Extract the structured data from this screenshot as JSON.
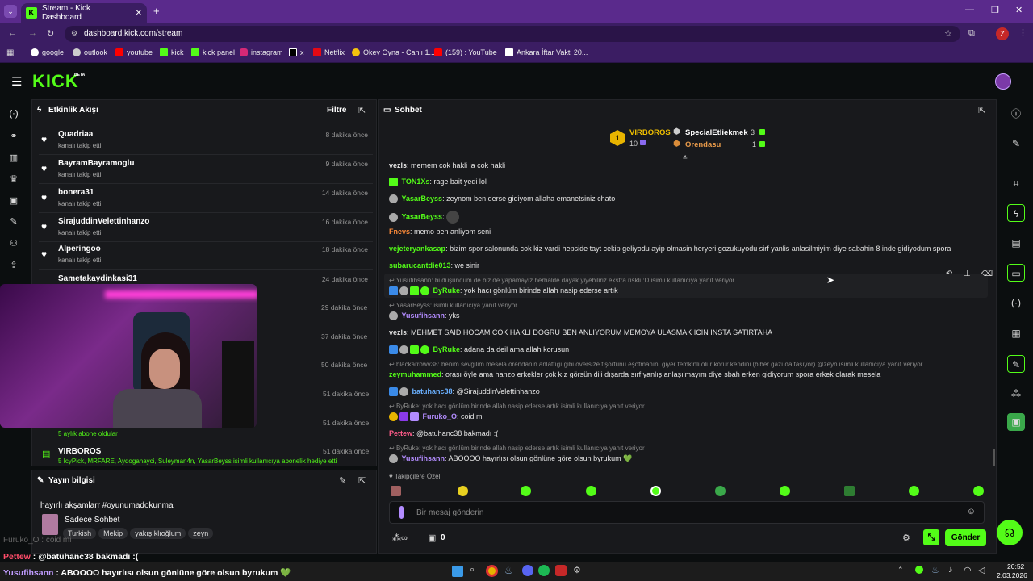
{
  "browser": {
    "tab_title": "Stream - Kick Dashboard",
    "url": "dashboard.kick.com/stream",
    "profile": "Z",
    "bookmarks": [
      "google",
      "outlook",
      "youtube",
      "kick",
      "kick panel",
      "instagram",
      "x",
      "Netflix",
      "Okey Oyna - Canlı 1...",
      "(159) : YouTube",
      "Ankara İftar Vakti 20..."
    ]
  },
  "app": {
    "logo": "KICK",
    "beta": "BETA"
  },
  "activity": {
    "title": "Etkinlik Akışı",
    "filter": "Filtre",
    "items": [
      {
        "name": "Quadriaa",
        "sub": "kanalı takip etti",
        "time": "8 dakika önce"
      },
      {
        "name": "BayramBayramoglu",
        "sub": "kanalı takip etti",
        "time": "9 dakika önce"
      },
      {
        "name": "bonera31",
        "sub": "kanalı takip etti",
        "time": "14 dakika önce"
      },
      {
        "name": "SirajuddinVelettinhanzo",
        "sub": "kanalı takip etti",
        "time": "16 dakika önce"
      },
      {
        "name": "Alperingoo",
        "sub": "kanalı takip etti",
        "time": "18 dakika önce"
      },
      {
        "name": "Sametakaydinkasi31",
        "sub": "",
        "time": "24 dakika önce"
      }
    ],
    "hidden_times": [
      "29 dakika önce",
      "37 dakika önce",
      "50 dakika önce",
      "51 dakika önce",
      "51 dakika önce"
    ],
    "sub_line": "5 aylık abone oldular",
    "gift_name": "VIRBOROS",
    "gift_time": "51 dakika önce",
    "gift_line": "5 IcyPick, MRFARE, Aydoganayci, Suleyman4n, YasarBeyss isimli kullanıcıya abonelik hediye etti"
  },
  "stream_info": {
    "title": "Yayın bilgisi",
    "stream_title": "hayırlı akşamlarr #oyunumadokunma",
    "category": "Sadece Sohbet",
    "tags": [
      "Turkish",
      "Mekip",
      "yakışıklıoğlum",
      "zeyn"
    ]
  },
  "chat": {
    "title": "Sohbet",
    "leaderboard": {
      "first": "VIRBOROS",
      "first_count": "10",
      "second": "SpecialEtliekmek",
      "second_count": "3",
      "third": "Orendasu",
      "third_count": "1"
    },
    "messages": [
      {
        "user": "vezls",
        "text": "memem cok hakli la cok hakli",
        "color": "#ddd"
      },
      {
        "user": "TON1Xs",
        "text": "rage bait yedi lol",
        "color": "#53fc18"
      },
      {
        "user": "YasarBeyss",
        "text": "zeynom ben derse gidiyom allaha emanetsiniz chato",
        "color": "#53fc18"
      },
      {
        "user": "YasarBeyss",
        "text": "",
        "color": "#53fc18"
      },
      {
        "user": "Fnevs",
        "text": "memo ben anliyom seni",
        "color": "#ff8c3a"
      },
      {
        "user": "vejeteryankasap",
        "text": "bizim spor salonunda cok kiz vardi hepside tayt cekip geliyodu ayip olmasin heryeri gozukuyodu sirf yanlis anlasilmiyim diye sabahin 8 inde gidiyodum spora",
        "color": "#53fc18"
      },
      {
        "user": "subarucantdie013",
        "text": "we sinir",
        "color": "#53fc18"
      },
      {
        "user": "ByRuke",
        "text": "yok hacı gönlüm birinde allah nasip ederse artık",
        "color": "#53fc18",
        "reply": "Yusufihsann: bi düşündüm de biz de yapamayız herhalde dayak yiyebiliriz ekstra riskli :D isimli kullanıcıya yanıt veriyor"
      },
      {
        "user": "Yusufihsann",
        "text": "yks",
        "color": "#b38cff",
        "reply": "YasarBeyss:  isimli kullanıcıya yanıt veriyor"
      },
      {
        "user": "vezls",
        "text": "MEHMET SAID HOCAM COK HAKLI DOGRU BEN ANLIYORUM MEMOYA ULASMAK ICIN INSTA SATIRTAHA",
        "color": "#ddd"
      },
      {
        "user": "ByRuke",
        "text": "adana da deil ama allah korusun",
        "color": "#53fc18"
      },
      {
        "user": "zeymuhammed",
        "text": "orası öyle ama hanzo erkekler çok kız görsün dili dışarda sırf yanlış anlaşılmayım diye sbah erken gidiyorum spora erkek olarak mesela",
        "color": "#53fc18",
        "reply": "blackarrowv38: benim sevgilim mesela orendanin anlattığı gibi oversize tişörtünü eşofmanını giyer temkinli olur korur kendini (biber gazı da taşıyor) @zeyn isimli kullanıcıya yanıt veriyor"
      },
      {
        "user": "batuhanc38",
        "text": "@SirajuddinVelettinhanzo",
        "color": "#6ab0ff"
      },
      {
        "user": "Furuko_O",
        "text": "coid mi",
        "color": "#b38cff",
        "reply": "ByRuke: yok hacı gönlüm birinde allah nasip ederse artık isimli kullanıcıya yanıt veriyor"
      },
      {
        "user": "Pettew",
        "text": "@batuhanc38 bakmadı :(",
        "color": "#ff5c8a"
      },
      {
        "user": "Yusufihsann",
        "text": "ABOOOO hayırlısı olsun gönlüne göre olsun byrukum 💚",
        "color": "#b38cff",
        "reply": "ByRuke: yok hacı gönlüm birinde allah nasip ederse artık isimli kullanıcıya yanıt veriyor"
      }
    ],
    "emote_label": "Takipçilere Özel",
    "input_placeholder": "Bir mesaj gönderin",
    "points": "0",
    "send": "Gönder"
  },
  "overlay": {
    "l1_user": "Furuko_O",
    "l1_text": "coid mi",
    "l2_user": "Pettew",
    "l2_text": "@batuhanc38 bakmadı :(",
    "l3_user": "Yusufihsann",
    "l3_text": "ABOOOO hayırlısı olsun gönlüne göre olsun byrukum 💚"
  },
  "taskbar": {
    "time": "20:52",
    "date": "2.03.2026"
  }
}
